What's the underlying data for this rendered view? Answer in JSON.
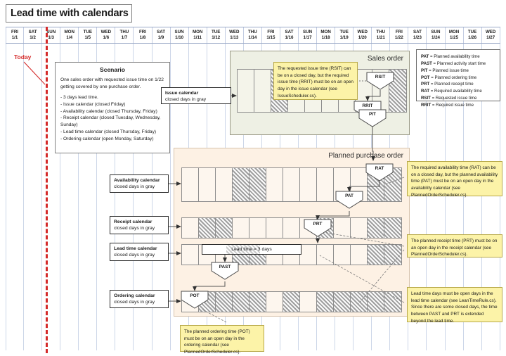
{
  "title": "Lead time with calendars",
  "today": {
    "label": "Today",
    "column_index": 2
  },
  "calendar_header": {
    "days": [
      {
        "dow": "FRI",
        "date": "1/1"
      },
      {
        "dow": "SAT",
        "date": "1/2"
      },
      {
        "dow": "SUN",
        "date": "1/3"
      },
      {
        "dow": "MON",
        "date": "1/4"
      },
      {
        "dow": "TUE",
        "date": "1/5"
      },
      {
        "dow": "WED",
        "date": "1/6"
      },
      {
        "dow": "THU",
        "date": "1/7"
      },
      {
        "dow": "FRI",
        "date": "1/8"
      },
      {
        "dow": "SAT",
        "date": "1/9"
      },
      {
        "dow": "SUN",
        "date": "1/10"
      },
      {
        "dow": "MON",
        "date": "1/11"
      },
      {
        "dow": "TUE",
        "date": "1/12"
      },
      {
        "dow": "WED",
        "date": "1/13"
      },
      {
        "dow": "THU",
        "date": "1/14"
      },
      {
        "dow": "FRI",
        "date": "1/15"
      },
      {
        "dow": "SAT",
        "date": "1/16"
      },
      {
        "dow": "SUN",
        "date": "1/17"
      },
      {
        "dow": "MON",
        "date": "1/18"
      },
      {
        "dow": "TUE",
        "date": "1/19"
      },
      {
        "dow": "WED",
        "date": "1/20"
      },
      {
        "dow": "THU",
        "date": "1/21"
      },
      {
        "dow": "FRI",
        "date": "1/22"
      },
      {
        "dow": "SAT",
        "date": "1/23"
      },
      {
        "dow": "SUN",
        "date": "1/24"
      },
      {
        "dow": "MON",
        "date": "1/25"
      },
      {
        "dow": "TUE",
        "date": "1/26"
      },
      {
        "dow": "WED",
        "date": "1/27"
      }
    ]
  },
  "scenario": {
    "title": "Scenario",
    "intro": "One sales order with requested issue time on 1/22 getting covered by one purchase order.",
    "bullets": [
      "- 3 days lead time.",
      "- Issue calendar (closed Friday)",
      "- Availability calendar (closed Thursday, Friday)",
      "- Receipt calendar (closed Tuesday, Wednesday, Sunday)",
      "- Lead time calendar (closed Thursday, Friday)",
      "- Ordering calendar (open Monday, Saturday)"
    ]
  },
  "legend": {
    "entries": [
      {
        "abbr": "PAT",
        "desc": " = Planned availability time"
      },
      {
        "abbr": "PAST",
        "desc": " = Planned activity start time"
      },
      {
        "abbr": "PIT",
        "desc": " = Planned issue time"
      },
      {
        "abbr": "POT",
        "desc": " = Planned ordering time"
      },
      {
        "abbr": "PRT",
        "desc": " = Planned receipt time"
      },
      {
        "abbr": "RAT",
        "desc": " = Required availability time"
      },
      {
        "abbr": "RSIT",
        "desc": " = Requested issue time"
      },
      {
        "abbr": "RRIT",
        "desc": " = Required issue time"
      }
    ]
  },
  "panels": {
    "sales_order": "Sales order",
    "planned_purchase_order": "Planned purchase order"
  },
  "calendar_labels": {
    "issue": {
      "name": "Issue calendar",
      "sub": "closed days in gray"
    },
    "availability": {
      "name": "Availability calendar",
      "sub": "closed days in gray"
    },
    "receipt": {
      "name": "Receipt calendar",
      "sub": "closed days in gray"
    },
    "leadtime": {
      "name": "Lead time calendar",
      "sub": "closed days in gray"
    },
    "ordering": {
      "name": "Ordering calendar",
      "sub": "closed days in gray"
    }
  },
  "strips": {
    "issue": {
      "cells": 10,
      "closed": [
        2,
        9
      ]
    },
    "availability": {
      "cells": 13,
      "closed": [
        3,
        4,
        11,
        12
      ]
    },
    "receipt": {
      "cells": 13,
      "closed": [
        1,
        2,
        8,
        11,
        12
      ]
    },
    "leadtime": {
      "cells": 13,
      "closed": [
        3,
        4,
        11,
        12
      ]
    },
    "ordering": {
      "cells": 13,
      "closed": [
        1,
        2,
        3,
        4,
        6,
        8,
        9,
        10,
        11,
        12
      ]
    }
  },
  "markers": {
    "rsit": "RSIT",
    "rrit": "RRIT",
    "pit": "PIT",
    "rat": "RAT",
    "pat": "PAT",
    "prt": "PRT",
    "past": "PAST",
    "pot": "POT"
  },
  "leadtime_bar": {
    "label": "Lead time = 3 days"
  },
  "notes": {
    "issue": "The requested issue time (RSIT) can be on a closed day, but the required issue time (RRIT) must be on an open day in the issue calendar (see IssueScheduler.cs).",
    "availability": "The required availability time (RAT) can be on a closed day, but the planned availability time (PAT) must be on an open day in the availability calendar (see PlannedOrderScheduler.cs).",
    "receipt": "The planned receipt time (PRT) must be on an open day in the receipt calendar (see PlannedOrderScheduler.cs).",
    "leadtime": "Lead time days must be open days in the lead time calendar (see LeanTimeRule.cs). Since there are some closed days, the time between PAST and PRT is extended beyond the lead time.",
    "ordering": "The planned ordering time (POT) must be on an open day in the ordering calendar (see PlannedOrderScheduler.cs)."
  },
  "colors": {
    "today": "#d42a2a",
    "sales_panel": "#eef0e4",
    "ppo_panel": "#fdf1e4",
    "note": "#fcf3a8"
  }
}
